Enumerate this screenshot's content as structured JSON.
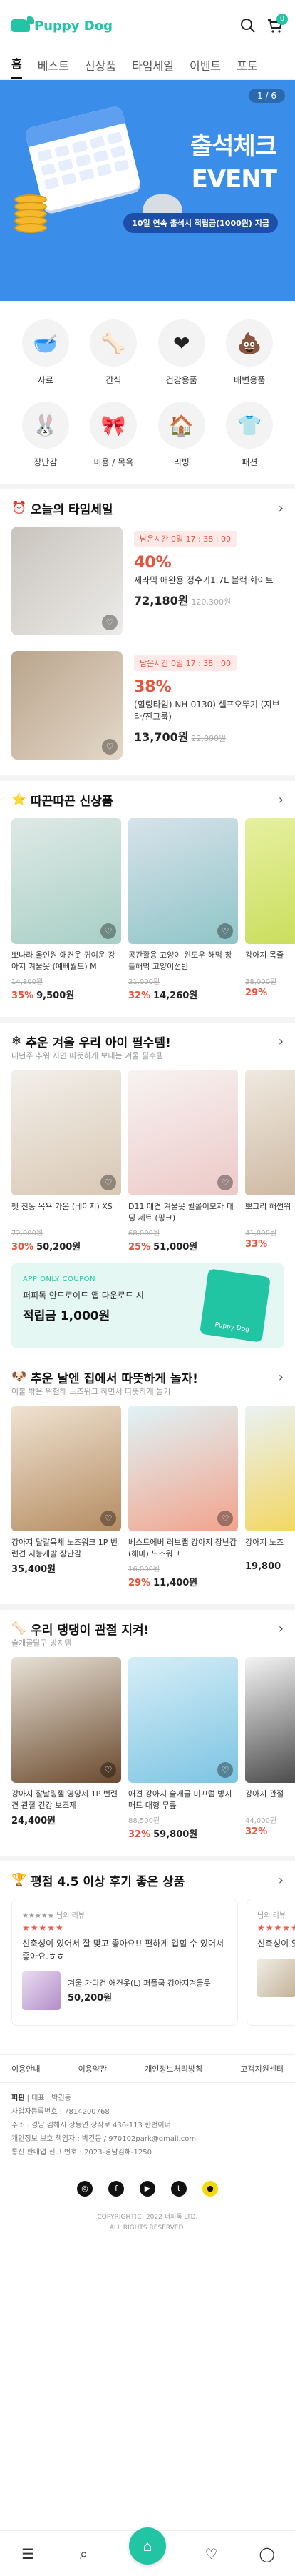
{
  "header": {
    "logo_text": "Puppy Dog",
    "cart_count": "0"
  },
  "tabs": [
    "홈",
    "베스트",
    "신상품",
    "타임세일",
    "이벤트",
    "포토"
  ],
  "banner": {
    "pager": "1 / 6",
    "title_line1": "출석체크",
    "title_line2": "EVENT",
    "subtitle": "10일 연속 출석시 적립금(1000원) 지급"
  },
  "categories": [
    {
      "label": "사료",
      "icon": "bowl-icon"
    },
    {
      "label": "간식",
      "icon": "bone-icon"
    },
    {
      "label": "건강용품",
      "icon": "health-icon"
    },
    {
      "label": "배변용품",
      "icon": "poop-icon"
    },
    {
      "label": "장난감",
      "icon": "toy-icon"
    },
    {
      "label": "미용 / 목욕",
      "icon": "ribbon-icon"
    },
    {
      "label": "리빙",
      "icon": "house-icon"
    },
    {
      "label": "패션",
      "icon": "shirt-icon"
    }
  ],
  "timesale": {
    "title": "오늘의 타임세일",
    "items": [
      {
        "timer": "남은시간 0일 17 : 38 : 00",
        "pct": "40%",
        "name": "세라믹 애완용 정수기1.7L 블랙 화이트",
        "price": "72,180원",
        "orig": "120,300원"
      },
      {
        "timer": "남은시간 0일 17 : 38 : 00",
        "pct": "38%",
        "name": "(힐링타임) NH-0130) 셀프오뚜기 (지브라/진그룹)",
        "price": "13,700원",
        "orig": "22,000원"
      }
    ]
  },
  "new_products": {
    "title": "따끈따끈 신상품",
    "items": [
      {
        "name": "뽀나라 올인원 애견옷 귀여운 강아지 겨울옷 (예뻐월드) M",
        "orig": "14,800원",
        "pct": "35%",
        "price": "9,500원"
      },
      {
        "name": "공간활용 고양이 윈도우 해먹 창틀해먹 고양이선반",
        "orig": "21,000원",
        "pct": "32%",
        "price": "14,260원"
      },
      {
        "name": "강아지 목줄",
        "orig": "38,000원",
        "pct": "29%",
        "price": ""
      }
    ]
  },
  "winter": {
    "title": "추운 겨울 우리 아이 필수템!",
    "subtitle": "내년주 추워 지면 따뜻하게 보내는 겨울 필수템",
    "items": [
      {
        "name": "펫 진동 목욕 가운 (베이지) XS",
        "orig": "72,000원",
        "pct": "30%",
        "price": "50,200원"
      },
      {
        "name": "D11 애견 겨울옷 퀼롤이모자 패딩 세트 (핑크)",
        "orig": "68,000원",
        "pct": "25%",
        "price": "51,000원"
      },
      {
        "name": "뽀그리 해썬워",
        "orig": "41,000원",
        "pct": "33%",
        "price": ""
      }
    ]
  },
  "coupon": {
    "tag": "APP ONLY COUPON",
    "text": "퍼피독 안드로이드 앱 다운로드 시",
    "big": "적립금 1,000원",
    "card_label": "Puppy Dog"
  },
  "indoor": {
    "title": "추운 날엔 집에서 따뜻하게 놀자!",
    "subtitle": "이불 밖은 위험해 노즈워크 하면서 따뜻하게 놀기",
    "items": [
      {
        "name": "강아지 달걀육체 노즈워크 1P 번련견 지능개발 장난감",
        "orig": "",
        "pct": "",
        "price": "35,400원"
      },
      {
        "name": "베스트에버 러브랩 강아지 장난감(해마) 노즈워크",
        "orig": "16,000원",
        "pct": "29%",
        "price": "11,400원"
      },
      {
        "name": "강아지 노즈",
        "orig": "",
        "pct": "",
        "price": "19,800"
      }
    ]
  },
  "joint": {
    "title": "우리 댕댕이 관절 지켜!",
    "subtitle": "슬개골탈구 방지템",
    "items": [
      {
        "name": "강아지 잘날링젤 영양제 1P 번련견 관절 건강 보조제",
        "orig": "",
        "pct": "",
        "price": "24,400원"
      },
      {
        "name": "애견 강아지 슬개골 미끄럼 방지 매트 대형 무릎",
        "orig": "88,500원",
        "pct": "32%",
        "price": "59,800원"
      },
      {
        "name": "강아지 관절",
        "orig": "44,000원",
        "pct": "32%",
        "price": ""
      }
    ]
  },
  "reviews": {
    "title": "평점 4.5 이상 후기 좋은 상품",
    "items": [
      {
        "user": "★★★★★ 님의 리뷰",
        "stars": "★★★★★",
        "text": "신축성이 있어서 잘 맞고 좋아요!! 편하게 입힐 수 있어서 좋아요.ㅎㅎ",
        "pname": "겨울 가디건 애견옷(L) 퍼플쿡 강아지겨울옷",
        "price": "50,200원"
      },
      {
        "user": "님의 리뷰",
        "stars": "★★★★★",
        "text": "신축성이 있어서 편하게 입힐 수",
        "pname": "",
        "price": ""
      }
    ]
  },
  "footer": {
    "links": [
      "이용안내",
      "이용약관",
      "개인정보처리방침",
      "고객지원센터"
    ],
    "company": "퍼핀",
    "ceo": "대표 : 박긴동",
    "biz_no": "사업자등록번호 : 7814200768",
    "address": "주소 : 경남 김해시 상동면 장작로 436-113 한번이너",
    "privacy": "개인정보 보호 책임자 : 박긴동 / 970102park@gmail.com",
    "mail_order": "통신 판매업 신고 번호 : 2023-경남김해-1250",
    "sns": [
      "instagram-icon",
      "facebook-icon",
      "youtube-icon",
      "twitter-icon",
      "kakao-icon"
    ],
    "copyright": "COPYRIGHT(C) 2022 퍼피독 LTD.",
    "rights": "ALL RIGHTS RESERVED."
  },
  "colors": {
    "accent": "#21c4a3",
    "banner": "#3a8de8",
    "sale": "#e8533c"
  }
}
